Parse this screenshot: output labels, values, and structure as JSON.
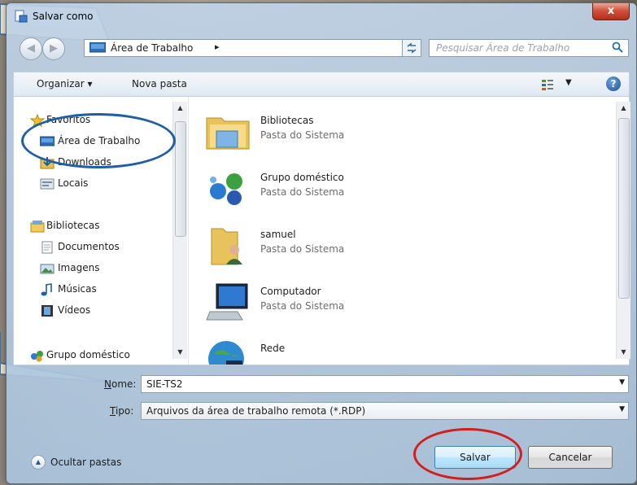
{
  "window": {
    "title": "Salvar como",
    "close_label": "x"
  },
  "nav": {
    "back_glyph": "◀",
    "forward_glyph": "▶",
    "address": "Área de Trabalho",
    "address_sep": "▸",
    "address_drop": "▾",
    "search_placeholder": "Pesquisar Área de Trabalho"
  },
  "toolbar": {
    "organize_label": "Organizar ▾",
    "new_folder_label": "Nova pasta",
    "help_label": "?"
  },
  "sidebar": {
    "items": [
      {
        "label": "Favoritos",
        "icon": "star-icon"
      },
      {
        "label": "Área de Trabalho",
        "icon": "desktop-icon"
      },
      {
        "label": "Downloads",
        "icon": "downloads-icon"
      },
      {
        "label": "Locais",
        "icon": "recent-places-icon"
      },
      {
        "label": "Bibliotecas",
        "icon": "libraries-icon"
      },
      {
        "label": "Documentos",
        "icon": "documents-icon"
      },
      {
        "label": "Imagens",
        "icon": "images-icon"
      },
      {
        "label": "Músicas",
        "icon": "music-icon"
      },
      {
        "label": "Vídeos",
        "icon": "videos-icon"
      },
      {
        "label": "Grupo doméstico",
        "icon": "homegroup-icon"
      }
    ]
  },
  "files": [
    {
      "name": "Bibliotecas",
      "sub": "Pasta do Sistema",
      "icon": "libraries-folder-icon"
    },
    {
      "name": "Grupo doméstico",
      "sub": "Pasta do Sistema",
      "icon": "homegroup-icon"
    },
    {
      "name": "samuel",
      "sub": "Pasta do Sistema",
      "icon": "user-folder-icon"
    },
    {
      "name": "Computador",
      "sub": "Pasta do Sistema",
      "icon": "computer-icon"
    },
    {
      "name": "Rede",
      "sub": "",
      "icon": "network-icon"
    }
  ],
  "form": {
    "name_label_first": "N",
    "name_label_rest": "ome:",
    "name_value": "SIE-TS2",
    "type_label_first": "T",
    "type_label_rest": "ipo:",
    "type_value": "Arquivos da área de trabalho remota (*.RDP)"
  },
  "footer": {
    "hide_folders_label": "Ocultar pastas",
    "save_label": "Salvar",
    "cancel_label": "Cancelar"
  },
  "colors": {
    "annotation_blue": "#1c5ea8",
    "annotation_red": "#d21e1e"
  }
}
